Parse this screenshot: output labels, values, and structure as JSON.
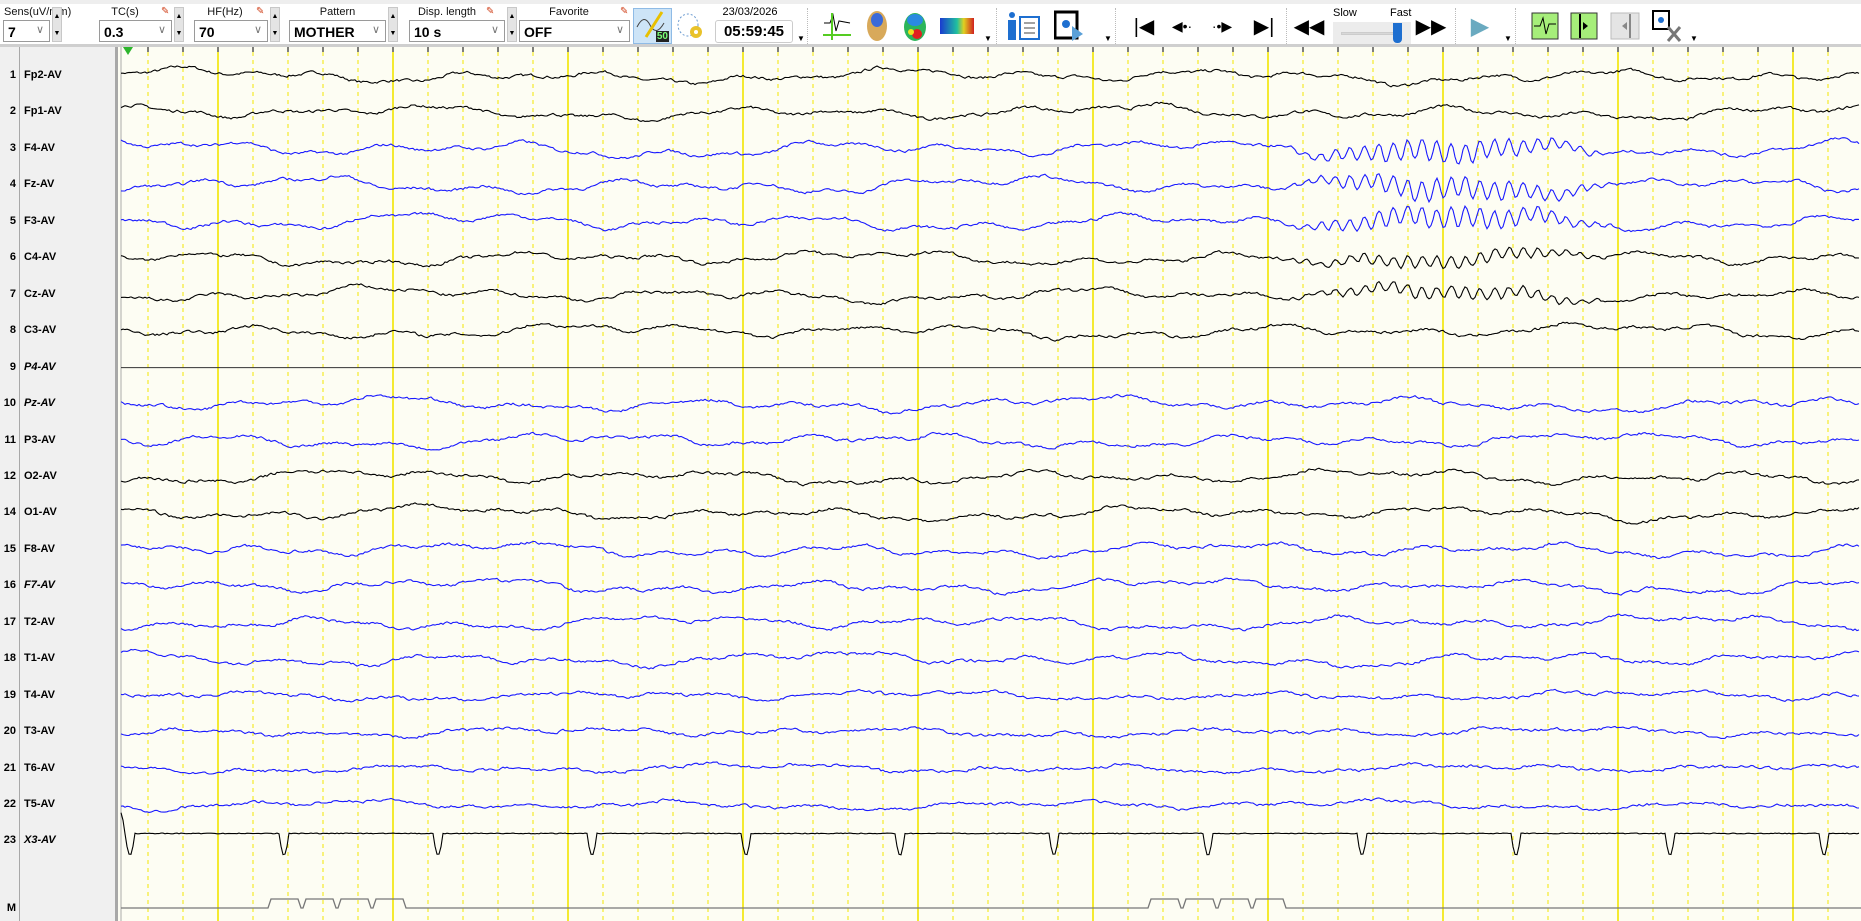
{
  "toolbar": {
    "sens": {
      "label": "Sens(uV/mm)",
      "value": "7"
    },
    "tc": {
      "label": "TC(s)",
      "value": "0.3"
    },
    "hf": {
      "label": "HF(Hz)",
      "value": "70"
    },
    "pattern": {
      "label": "Pattern",
      "value": "MOTHER"
    },
    "disp_length": {
      "label": "Disp. length",
      "value": "10 s"
    },
    "favorite": {
      "label": "Favorite",
      "value": "OFF"
    },
    "notch_badge": "50",
    "date": "23/03/2026",
    "time": "05:59:45",
    "speed": {
      "slow_label": "Slow",
      "fast_label": "Fast",
      "value_percent": 95
    }
  },
  "channels": [
    {
      "num": "1",
      "name": "Fp2-AV",
      "color": "#000000",
      "italic": false
    },
    {
      "num": "2",
      "name": "Fp1-AV",
      "color": "#000000",
      "italic": false
    },
    {
      "num": "3",
      "name": "F4-AV",
      "color": "#1a1aff",
      "italic": false
    },
    {
      "num": "4",
      "name": "Fz-AV",
      "color": "#1a1aff",
      "italic": false
    },
    {
      "num": "5",
      "name": "F3-AV",
      "color": "#1a1aff",
      "italic": false
    },
    {
      "num": "6",
      "name": "C4-AV",
      "color": "#000000",
      "italic": false
    },
    {
      "num": "7",
      "name": "Cz-AV",
      "color": "#000000",
      "italic": false
    },
    {
      "num": "8",
      "name": "C3-AV",
      "color": "#000000",
      "italic": false
    },
    {
      "num": "9",
      "name": "P4-AV",
      "color": "#000000",
      "italic": true
    },
    {
      "num": "10",
      "name": "Pz-AV",
      "color": "#1a1aff",
      "italic": true
    },
    {
      "num": "11",
      "name": "P3-AV",
      "color": "#1a1aff",
      "italic": false
    },
    {
      "num": "12",
      "name": "O2-AV",
      "color": "#000000",
      "italic": false
    },
    {
      "num": "14",
      "name": "O1-AV",
      "color": "#000000",
      "italic": false
    },
    {
      "num": "15",
      "name": "F8-AV",
      "color": "#1a1aff",
      "italic": false
    },
    {
      "num": "16",
      "name": "F7-AV",
      "color": "#1a1aff",
      "italic": true
    },
    {
      "num": "17",
      "name": "T2-AV",
      "color": "#1a1aff",
      "italic": false
    },
    {
      "num": "18",
      "name": "T1-AV",
      "color": "#1a1aff",
      "italic": false
    },
    {
      "num": "19",
      "name": "T4-AV",
      "color": "#1a1aff",
      "italic": false
    },
    {
      "num": "20",
      "name": "T3-AV",
      "color": "#1a1aff",
      "italic": false
    },
    {
      "num": "21",
      "name": "T6-AV",
      "color": "#1a1aff",
      "italic": false
    },
    {
      "num": "22",
      "name": "T5-AV",
      "color": "#1a1aff",
      "italic": false
    },
    {
      "num": "23",
      "name": "X3-AV",
      "color": "#000000",
      "italic": true
    }
  ],
  "marker_row": {
    "num": "M"
  },
  "colors": {
    "background": "#fdfdf3",
    "grid": "#f2e600",
    "label_panel": "#f0f0f0"
  }
}
